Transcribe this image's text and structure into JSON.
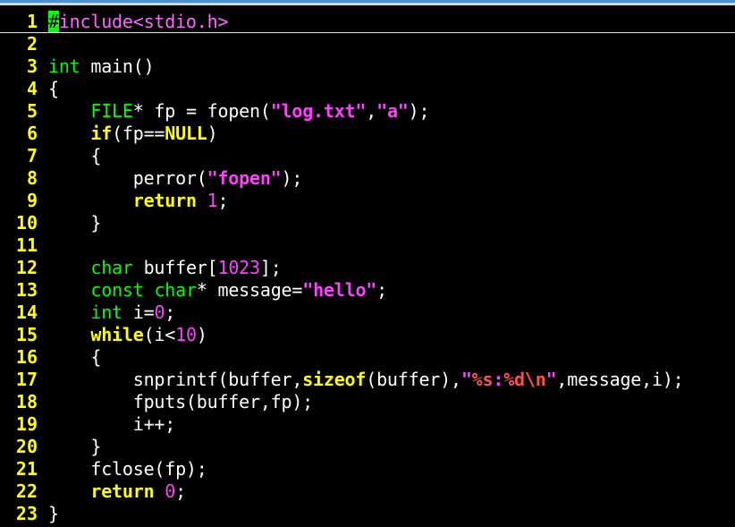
{
  "editor": {
    "lines": [
      {
        "num": "1",
        "tokens": [
          {
            "t": "#",
            "c": "cur"
          },
          {
            "t": "include<stdio.h>",
            "c": "pp"
          }
        ]
      },
      {
        "num": "2",
        "tokens": []
      },
      {
        "num": "3",
        "tokens": [
          {
            "t": "int",
            "c": "ty"
          },
          {
            "t": " main()",
            "c": ""
          }
        ]
      },
      {
        "num": "4",
        "tokens": [
          {
            "t": "{",
            "c": ""
          }
        ]
      },
      {
        "num": "5",
        "tokens": [
          {
            "t": "    ",
            "c": ""
          },
          {
            "t": "FILE",
            "c": "ty"
          },
          {
            "t": "* fp = fopen(",
            "c": ""
          },
          {
            "t": "\"log.txt\"",
            "c": "st"
          },
          {
            "t": ",",
            "c": ""
          },
          {
            "t": "\"a\"",
            "c": "st"
          },
          {
            "t": ");",
            "c": ""
          }
        ]
      },
      {
        "num": "6",
        "tokens": [
          {
            "t": "    ",
            "c": ""
          },
          {
            "t": "if",
            "c": "kw"
          },
          {
            "t": "(fp==",
            "c": ""
          },
          {
            "t": "NULL",
            "c": "kw"
          },
          {
            "t": ")",
            "c": ""
          }
        ]
      },
      {
        "num": "7",
        "tokens": [
          {
            "t": "    {",
            "c": ""
          }
        ]
      },
      {
        "num": "8",
        "tokens": [
          {
            "t": "        perror(",
            "c": ""
          },
          {
            "t": "\"fopen\"",
            "c": "st"
          },
          {
            "t": ");",
            "c": ""
          }
        ]
      },
      {
        "num": "9",
        "tokens": [
          {
            "t": "        ",
            "c": ""
          },
          {
            "t": "return",
            "c": "kw"
          },
          {
            "t": " ",
            "c": ""
          },
          {
            "t": "1",
            "c": "nu"
          },
          {
            "t": ";",
            "c": ""
          }
        ]
      },
      {
        "num": "10",
        "tokens": [
          {
            "t": "    }",
            "c": ""
          }
        ]
      },
      {
        "num": "11",
        "tokens": []
      },
      {
        "num": "12",
        "tokens": [
          {
            "t": "    ",
            "c": ""
          },
          {
            "t": "char",
            "c": "ty"
          },
          {
            "t": " buffer[",
            "c": ""
          },
          {
            "t": "1023",
            "c": "nu"
          },
          {
            "t": "];",
            "c": ""
          }
        ]
      },
      {
        "num": "13",
        "tokens": [
          {
            "t": "    ",
            "c": ""
          },
          {
            "t": "const",
            "c": "ty"
          },
          {
            "t": " ",
            "c": ""
          },
          {
            "t": "char",
            "c": "ty"
          },
          {
            "t": "* message=",
            "c": ""
          },
          {
            "t": "\"hello\"",
            "c": "st"
          },
          {
            "t": ";",
            "c": ""
          }
        ]
      },
      {
        "num": "14",
        "tokens": [
          {
            "t": "    ",
            "c": ""
          },
          {
            "t": "int",
            "c": "ty"
          },
          {
            "t": " i=",
            "c": ""
          },
          {
            "t": "0",
            "c": "nu"
          },
          {
            "t": ";",
            "c": ""
          }
        ]
      },
      {
        "num": "15",
        "tokens": [
          {
            "t": "    ",
            "c": ""
          },
          {
            "t": "while",
            "c": "kw"
          },
          {
            "t": "(i<",
            "c": ""
          },
          {
            "t": "10",
            "c": "nu"
          },
          {
            "t": ")",
            "c": ""
          }
        ]
      },
      {
        "num": "16",
        "tokens": [
          {
            "t": "    {",
            "c": ""
          }
        ]
      },
      {
        "num": "17",
        "tokens": [
          {
            "t": "        snprintf(buffer,",
            "c": ""
          },
          {
            "t": "sizeof",
            "c": "kw"
          },
          {
            "t": "(buffer),",
            "c": ""
          },
          {
            "t": "\"",
            "c": "st"
          },
          {
            "t": "%s",
            "c": "sp"
          },
          {
            "t": ":",
            "c": "st"
          },
          {
            "t": "%d\\n",
            "c": "sp"
          },
          {
            "t": "\"",
            "c": "st"
          },
          {
            "t": ",message,i);",
            "c": ""
          }
        ]
      },
      {
        "num": "18",
        "tokens": [
          {
            "t": "        fputs(buffer,fp);",
            "c": ""
          }
        ]
      },
      {
        "num": "19",
        "tokens": [
          {
            "t": "        i++;",
            "c": ""
          }
        ]
      },
      {
        "num": "20",
        "tokens": [
          {
            "t": "    }",
            "c": ""
          }
        ]
      },
      {
        "num": "21",
        "tokens": [
          {
            "t": "    fclose(fp);",
            "c": ""
          }
        ]
      },
      {
        "num": "22",
        "tokens": [
          {
            "t": "    ",
            "c": ""
          },
          {
            "t": "return",
            "c": "kw"
          },
          {
            "t": " ",
            "c": ""
          },
          {
            "t": "0",
            "c": "nu"
          },
          {
            "t": ";",
            "c": ""
          }
        ]
      },
      {
        "num": "23",
        "tokens": [
          {
            "t": "}",
            "c": ""
          }
        ]
      }
    ]
  },
  "colors": {
    "background": "#000000",
    "line_number": "#ffff00",
    "keyword": "#ffff00",
    "type": "#00ff00",
    "preprocessor": "#ff66ff",
    "string": "#ff40ff",
    "cursor": "#00ff00"
  }
}
